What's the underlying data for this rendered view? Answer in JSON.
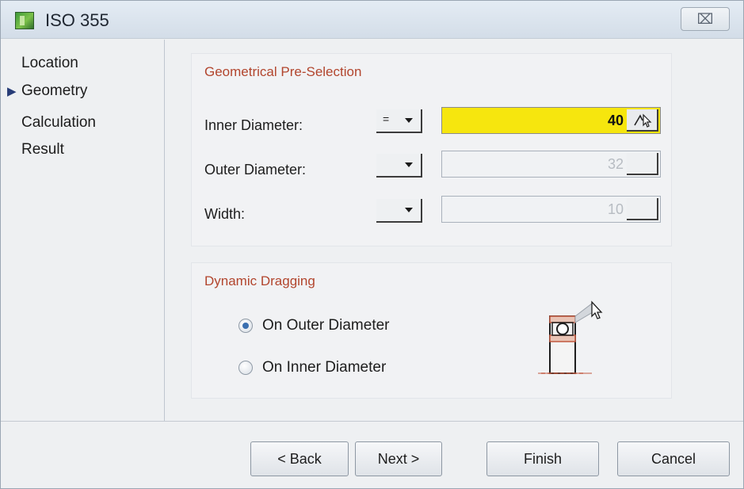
{
  "window": {
    "title": "ISO 355",
    "close_symbol": "⌧"
  },
  "nav": {
    "active_marker": "▶",
    "items": [
      {
        "label": "Location",
        "active": false
      },
      {
        "label": "Geometry",
        "active": true
      },
      {
        "label": "Calculation",
        "active": false
      },
      {
        "label": "Result",
        "active": false
      }
    ]
  },
  "preselection": {
    "title": "Geometrical Pre-Selection",
    "fields": [
      {
        "label": "Inner Diameter:",
        "operator": "=",
        "value": "40",
        "state": "active"
      },
      {
        "label": "Outer Diameter:",
        "operator": "",
        "value": "32",
        "state": "disabled"
      },
      {
        "label": "Width:",
        "operator": "",
        "value": "10",
        "state": "disabled"
      }
    ]
  },
  "dragging": {
    "title": "Dynamic Dragging",
    "options": [
      {
        "label": "On Outer Diameter",
        "checked": true
      },
      {
        "label": "On Inner Diameter",
        "checked": false
      }
    ]
  },
  "buttons": {
    "back": "< Back",
    "next": "Next >",
    "finish": "Finish",
    "cancel": "Cancel"
  },
  "colors": {
    "active_field": "#f6e60e",
    "group_title": "#b2452d",
    "bearing_outline": "#c1583e"
  },
  "icons": {
    "app": "app-icon",
    "measure": "measure-icon",
    "bearing": "bearing-icon",
    "close": "close-icon"
  }
}
